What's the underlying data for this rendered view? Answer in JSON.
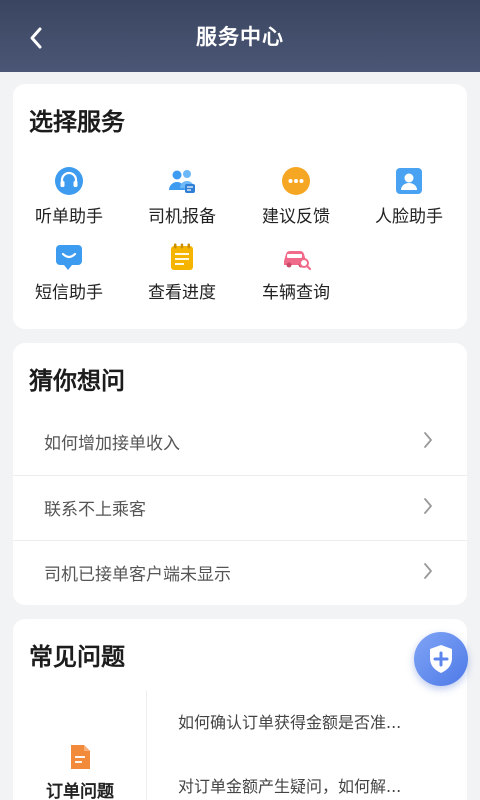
{
  "header": {
    "title": "服务中心"
  },
  "services": {
    "title": "选择服务",
    "items": [
      {
        "label": "听单助手",
        "icon": "headset-icon"
      },
      {
        "label": "司机报备",
        "icon": "drivers-group-icon"
      },
      {
        "label": "建议反馈",
        "icon": "feedback-chat-icon"
      },
      {
        "label": "人脸助手",
        "icon": "face-id-icon"
      },
      {
        "label": "短信助手",
        "icon": "sms-icon"
      },
      {
        "label": "查看进度",
        "icon": "progress-notepad-icon"
      },
      {
        "label": "车辆查询",
        "icon": "car-search-icon"
      }
    ]
  },
  "guess": {
    "title": "猜你想问",
    "items": [
      "如何增加接单收入",
      "联系不上乘客",
      "司机已接单客户端未显示"
    ]
  },
  "faq": {
    "title": "常见问题",
    "category": "订单问题",
    "items": [
      "如何确认订单获得金额是否准...",
      "对订单金额产生疑问，如何解..."
    ]
  },
  "colors": {
    "header": "#3e4a66",
    "accent_blue": "#3d9bf0",
    "accent_orange": "#f5a623",
    "accent_pink": "#f06a8a",
    "fab": "#5b84ec"
  }
}
